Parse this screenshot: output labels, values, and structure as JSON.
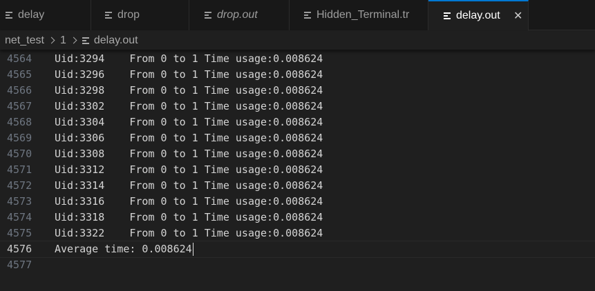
{
  "tabs": [
    {
      "label": "delay",
      "italic": false,
      "active": false
    },
    {
      "label": "drop",
      "italic": false,
      "active": false
    },
    {
      "label": "drop.out",
      "italic": true,
      "active": false
    },
    {
      "label": "Hidden_Terminal.tr",
      "italic": false,
      "active": false
    },
    {
      "label": "delay.out",
      "italic": false,
      "active": true,
      "close": "✕"
    }
  ],
  "breadcrumb": {
    "folder": "net_test",
    "subfolder": "1",
    "file": "delay.out"
  },
  "editor": {
    "lines": [
      {
        "num": "4564",
        "text": "Uid:3294    From 0 to 1 Time usage:0.008624"
      },
      {
        "num": "4565",
        "text": "Uid:3296    From 0 to 1 Time usage:0.008624"
      },
      {
        "num": "4566",
        "text": "Uid:3298    From 0 to 1 Time usage:0.008624"
      },
      {
        "num": "4567",
        "text": "Uid:3302    From 0 to 1 Time usage:0.008624"
      },
      {
        "num": "4568",
        "text": "Uid:3304    From 0 to 1 Time usage:0.008624"
      },
      {
        "num": "4569",
        "text": "Uid:3306    From 0 to 1 Time usage:0.008624"
      },
      {
        "num": "4570",
        "text": "Uid:3308    From 0 to 1 Time usage:0.008624"
      },
      {
        "num": "4571",
        "text": "Uid:3312    From 0 to 1 Time usage:0.008624"
      },
      {
        "num": "4572",
        "text": "Uid:3314    From 0 to 1 Time usage:0.008624"
      },
      {
        "num": "4573",
        "text": "Uid:3316    From 0 to 1 Time usage:0.008624"
      },
      {
        "num": "4574",
        "text": "Uid:3318    From 0 to 1 Time usage:0.008624"
      },
      {
        "num": "4575",
        "text": "Uid:3322    From 0 to 1 Time usage:0.008624"
      },
      {
        "num": "4576",
        "text": "Average time: 0.008624",
        "current": true
      },
      {
        "num": "4577",
        "text": ""
      }
    ]
  },
  "colors": {
    "accent": "#0078d4",
    "editor_bg": "#1f1f1f",
    "tabbar_bg": "#181818"
  },
  "icons": {
    "file": "file-lines-icon",
    "close": "close-icon",
    "breadcrumb_separator": "chevron-right-icon"
  }
}
